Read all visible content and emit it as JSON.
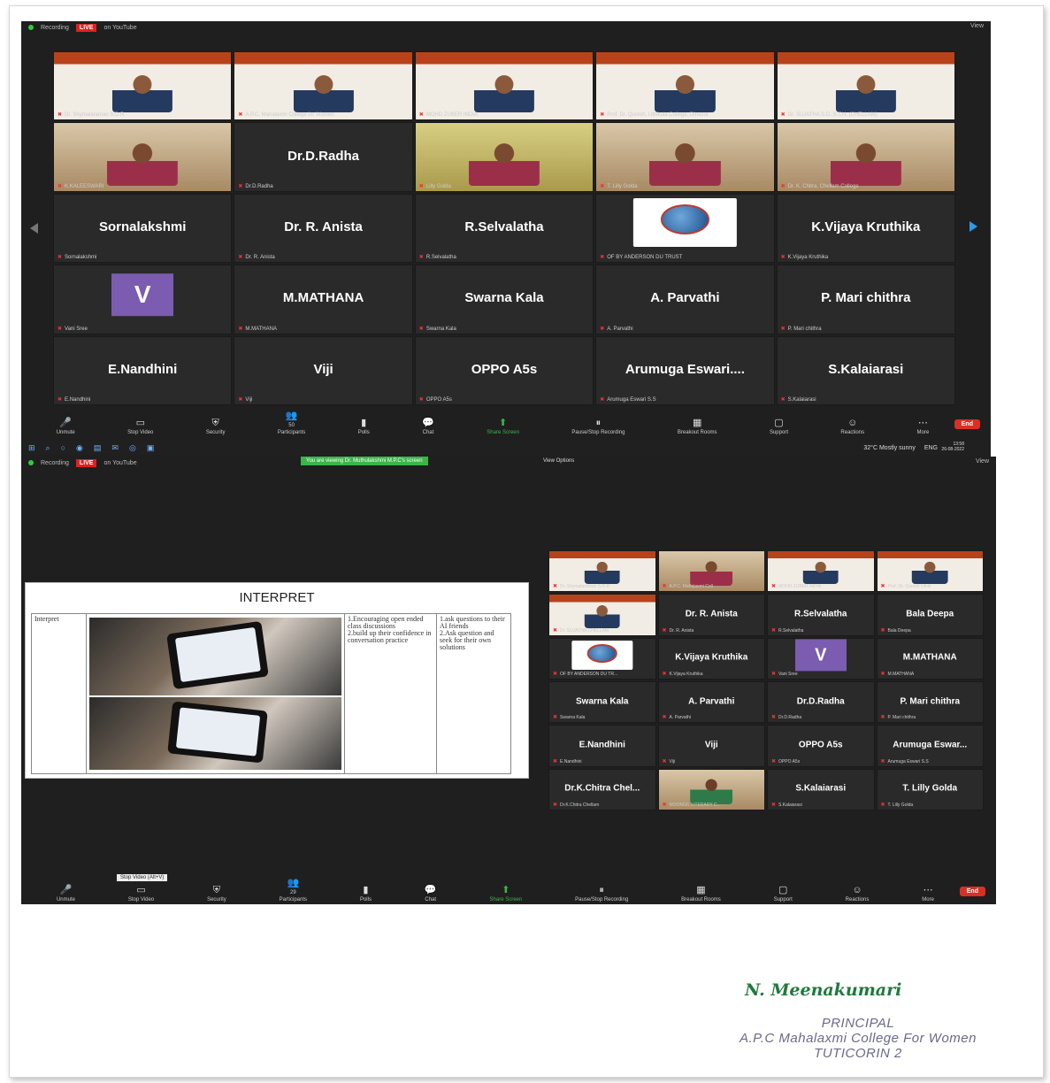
{
  "screenshot1": {
    "topbar": {
      "status_text": "Recording",
      "live_label": "LIVE",
      "live_target": "on YouTube",
      "view_label": "View"
    },
    "banner_row": [
      {
        "caption": "Dr. Shymalaraman S.D.R"
      },
      {
        "caption": "A.P.C. Mahalaxmi College for Women"
      },
      {
        "caption": "MOHD ZUBER INDIA"
      },
      {
        "caption": "Prof. Dr. Quresh, Uthikula College, Director"
      },
      {
        "caption": "Dr. SUJATHA S.D. S.T.H. (CHELLAM)"
      }
    ],
    "banner_title": "INTERNATIONAL VIRTUAL CONFERENCE ON RESEARCH AND EDUCATION: REFORMS IN THE 21ST CENTURY",
    "row2": [
      {
        "caption": "K.KALEESWARI"
      },
      {
        "name": "Dr.D.Radha",
        "caption": "Dr.D.Radha"
      },
      {
        "caption": "Lilly Golda"
      },
      {
        "caption": "T. Lilly Golda"
      },
      {
        "caption": "Dr. K. Chitra, Chellam College"
      }
    ],
    "row3": [
      {
        "name": "Sornalakshmi",
        "caption": "Sornalakshmi"
      },
      {
        "name": "Dr. R. Anista",
        "caption": "Dr. R. Anista"
      },
      {
        "name": "R.Selvalatha",
        "caption": "R.Selvalatha"
      },
      {
        "caption": "OF BY ANDERSON DU TRUST"
      },
      {
        "name": "K.Vijaya Kruthika",
        "caption": "K.Vijaya Kruthika"
      }
    ],
    "row4": [
      {
        "letter": "V",
        "caption": "Vani Sree"
      },
      {
        "name": "M.MATHANA",
        "caption": "M.MATHANA"
      },
      {
        "name": "Swarna Kala",
        "caption": "Swarna Kala"
      },
      {
        "name": "A. Parvathi",
        "caption": "A. Parvathi"
      },
      {
        "name": "P. Mari chithra",
        "caption": "P. Mari chithra"
      }
    ],
    "row5": [
      {
        "name": "E.Nandhini",
        "caption": "E.Nandhini"
      },
      {
        "name": "Viji",
        "caption": "Viji"
      },
      {
        "name": "OPPO A5s",
        "caption": "OPPO A5s"
      },
      {
        "name": "Arumuga  Eswari....",
        "caption": "Arumuga Eswari S.S"
      },
      {
        "name": "S.Kalaiarasi",
        "caption": "S.Kalaiarasi"
      }
    ],
    "toolbar": [
      {
        "icon": "mic-icon",
        "glyph": "🎤",
        "label": "Unmute"
      },
      {
        "icon": "video-icon",
        "glyph": "▭",
        "label": "Stop Video"
      },
      {
        "icon": "shield-icon",
        "glyph": "⛨",
        "label": "Security"
      },
      {
        "icon": "participants-icon",
        "glyph": "👥",
        "label": "Participants",
        "count": "50"
      },
      {
        "icon": "polls-icon",
        "glyph": "▮",
        "label": "Polls"
      },
      {
        "icon": "chat-icon",
        "glyph": "💬",
        "label": "Chat"
      },
      {
        "icon": "share-screen-icon",
        "glyph": "⬆",
        "label": "Share Screen"
      },
      {
        "icon": "recording-icon",
        "glyph": "⏸",
        "label": "Pause/Stop Recording"
      },
      {
        "icon": "breakout-icon",
        "glyph": "▦",
        "label": "Breakout Rooms"
      },
      {
        "icon": "support-icon",
        "glyph": "▢",
        "label": "Support"
      },
      {
        "icon": "reactions-icon",
        "glyph": "☺",
        "label": "Reactions"
      },
      {
        "icon": "more-icon",
        "glyph": "⋯",
        "label": "More"
      }
    ],
    "end_label": "End",
    "taskbar": {
      "weather": "32°C  Mostly sunny",
      "lang": "ENG",
      "time": "13:58",
      "date": "26-08-2022"
    }
  },
  "screenshot2": {
    "topbar": {
      "status_text": "Recording",
      "live_label": "LIVE",
      "live_target": "on YouTube",
      "view_label": "View"
    },
    "viewing_text": "You are viewing Dr. Muthulakshmi M.P.C's screen",
    "view_options": "View Options",
    "slide": {
      "title": "INTERPRET",
      "col1": "Interpret",
      "col3_lines": [
        "1.Encouraging open ended class discussions",
        "2.build up their confidence in conversation practice"
      ],
      "col4_lines": [
        "1.ask questions to their AI friends",
        "2.Ask question and seek for their own solutions"
      ]
    },
    "gallery": [
      {
        "type": "banner",
        "caption": "Dr. Shymalaraman S.D.R"
      },
      {
        "type": "cam",
        "caption": "A.P.C. Mahalaxmi Coll"
      },
      {
        "type": "banner",
        "caption": "MOHD ZUBER INDIA"
      },
      {
        "type": "banner",
        "caption": "Prof. Dr. Quresh Uthik"
      },
      {
        "type": "banner",
        "caption": "Dr. SUJATHA CHELLAM"
      },
      {
        "type": "name",
        "name": "Dr. R. Anista",
        "caption": "Dr. R. Anista"
      },
      {
        "type": "name",
        "name": "R.Selvalatha",
        "caption": "R.Selvalatha"
      },
      {
        "type": "name",
        "name": "Bala Deepa",
        "caption": "Bala Deepa"
      },
      {
        "type": "logo",
        "caption": "OF BY ANDERSON DU TR..."
      },
      {
        "type": "name",
        "name": "K.Vijaya Kruthika",
        "caption": "K.Vijaya Kruthika"
      },
      {
        "type": "letter",
        "letter": "V",
        "caption": "Vani Sree"
      },
      {
        "type": "name",
        "name": "M.MATHANA",
        "caption": "M.MATHANA"
      },
      {
        "type": "name",
        "name": "Swarna Kala",
        "caption": "Swarna Kala"
      },
      {
        "type": "name",
        "name": "A. Parvathi",
        "caption": "A. Parvathi"
      },
      {
        "type": "name",
        "name": "Dr.D.Radha",
        "caption": "Dr.D.Radha"
      },
      {
        "type": "name",
        "name": "P. Mari chithra",
        "caption": "P. Mari chithra"
      },
      {
        "type": "name",
        "name": "E.Nandhini",
        "caption": "E.Nandhini"
      },
      {
        "type": "name",
        "name": "Viji",
        "caption": "Viji"
      },
      {
        "type": "name",
        "name": "OPPO A5s",
        "caption": "OPPO A5s"
      },
      {
        "type": "name",
        "name": "Arumuga  Eswar...",
        "caption": "Arumuga Eswari S.S"
      },
      {
        "type": "name",
        "name": "Dr.K.Chitra  Chel...",
        "caption": "Dr.K.Chitra Chellam"
      },
      {
        "type": "image",
        "caption": "MOONGIL LITERARY C..."
      },
      {
        "type": "name",
        "name": "S.Kalaiarasi",
        "caption": "S.Kalaiarasi"
      },
      {
        "type": "name",
        "name": "T. Lilly Golda",
        "caption": "T. Lilly Golda"
      }
    ],
    "toolbar": [
      {
        "icon": "mic-icon",
        "glyph": "🎤",
        "label": "Unmute"
      },
      {
        "icon": "video-icon",
        "glyph": "▭",
        "label": "Stop Video"
      },
      {
        "icon": "shield-icon",
        "glyph": "⛨",
        "label": "Security"
      },
      {
        "icon": "participants-icon",
        "glyph": "👥",
        "label": "Participants",
        "count": "29"
      },
      {
        "icon": "polls-icon",
        "glyph": "▮",
        "label": "Polls"
      },
      {
        "icon": "chat-icon",
        "glyph": "💬",
        "label": "Chat"
      },
      {
        "icon": "share-screen-icon",
        "glyph": "⬆",
        "label": "Share Screen"
      },
      {
        "icon": "recording-icon",
        "glyph": "⏸",
        "label": "Pause/Stop Recording"
      },
      {
        "icon": "breakout-icon",
        "glyph": "▦",
        "label": "Breakout Rooms"
      },
      {
        "icon": "support-icon",
        "glyph": "▢",
        "label": "Support"
      },
      {
        "icon": "reactions-icon",
        "glyph": "☺",
        "label": "Reactions"
      },
      {
        "icon": "more-icon",
        "glyph": "⋯",
        "label": "More"
      }
    ],
    "tooltip": "Stop Video (Alt+V)",
    "end_label": "End"
  },
  "signature": "N. Meenakumari",
  "stamp": {
    "line1": "PRINCIPAL",
    "line2": "A.P.C Mahalaxmi College For Women",
    "line3": "TUTICORIN  2"
  },
  "colors": {
    "zoom_bg": "#1f1f1f",
    "tile_bg": "#2a2a2a",
    "end_red": "#d93025",
    "share_green": "#3bb54a",
    "avatar_purple": "#7b5cb0",
    "signature_green": "#1f7a3a"
  }
}
